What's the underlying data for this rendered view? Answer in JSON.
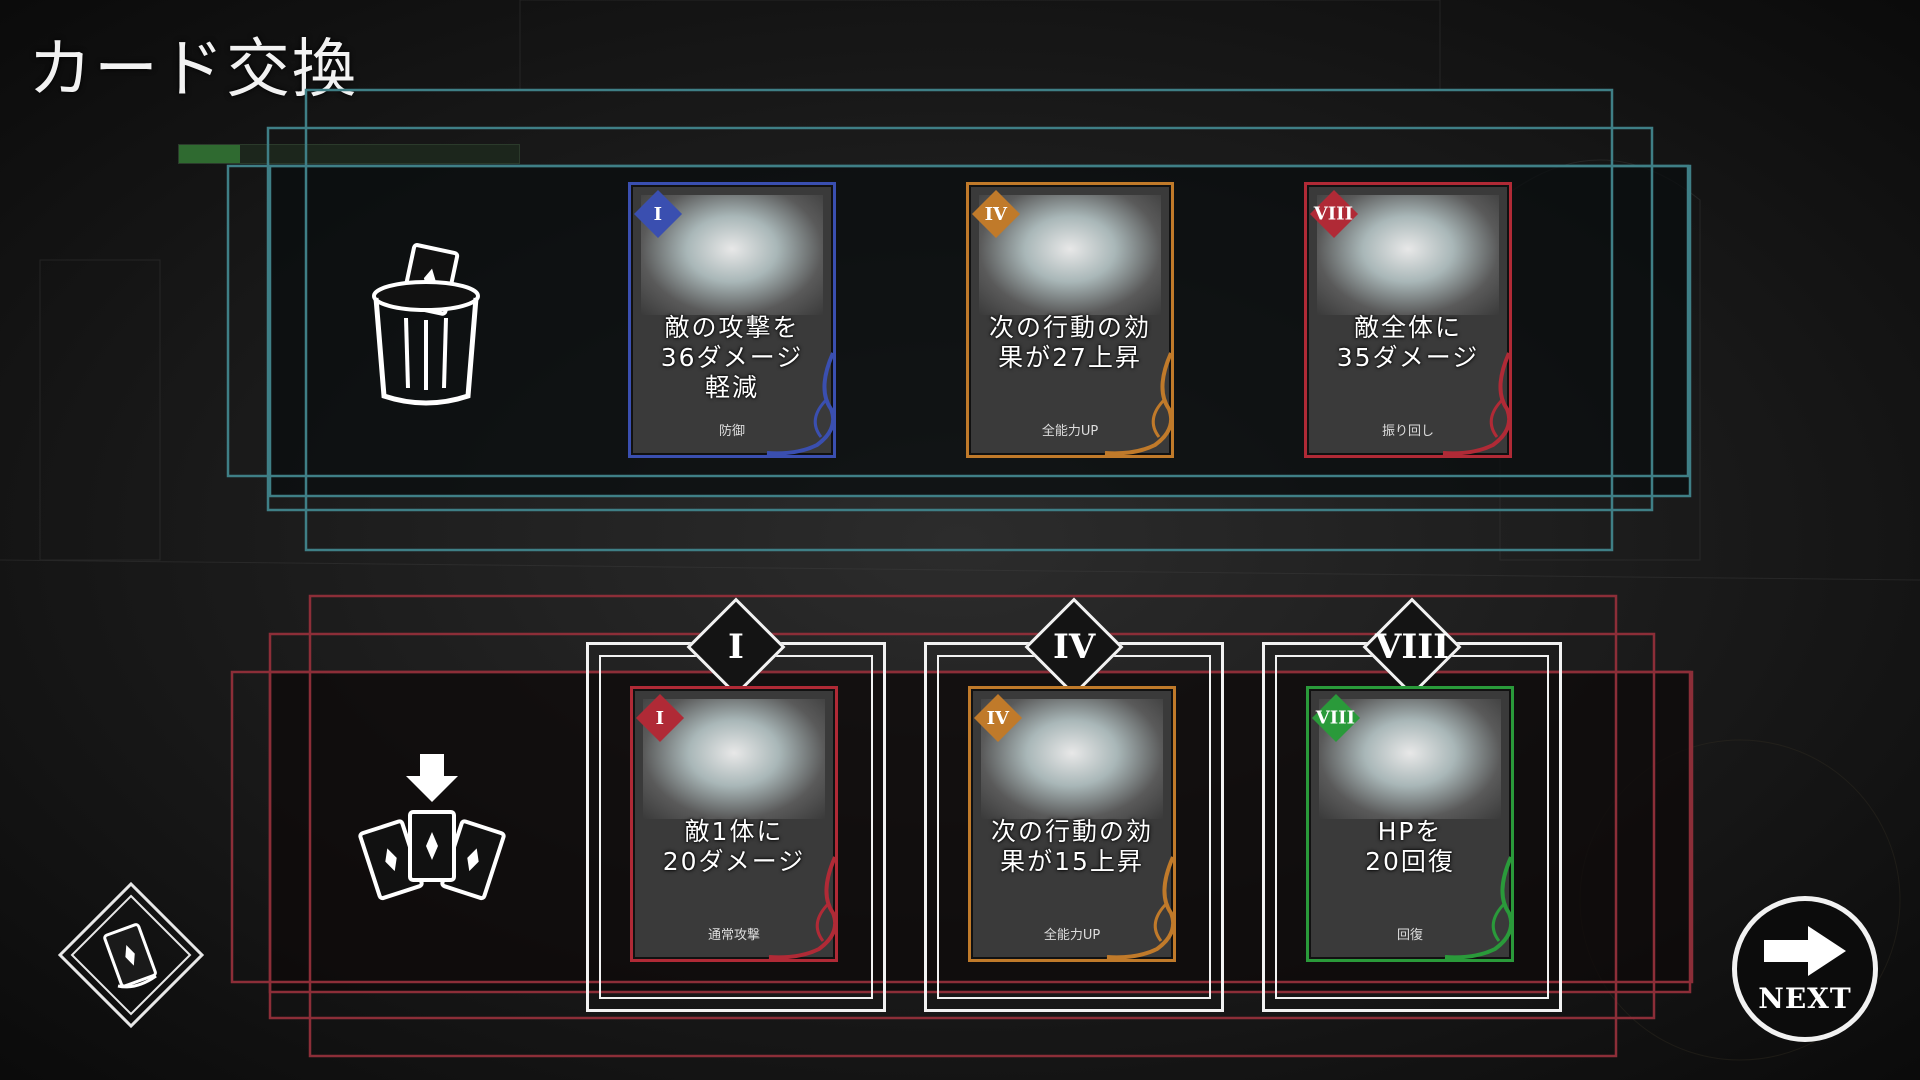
{
  "title": "カード交換",
  "hp": {
    "label": "",
    "ratio": 0.18
  },
  "colors": {
    "discard_frame": "#3f7f86",
    "hand_frame": "#8c2e38",
    "panel_bg": "#0a0d0f",
    "hand_bg": "#0e0909"
  },
  "discard_icon": "trash-can-with-card-icon",
  "draw_icon": "draw-cards-icon",
  "deck_icon": "deck-diamond-icon",
  "discard_cards": [
    {
      "numeral": "I",
      "color": "#3a4fb0",
      "text": "敵の攻撃を\n36ダメージ\n軽減",
      "type": "防御"
    },
    {
      "numeral": "IV",
      "color": "#c07a2a",
      "text": "次の行動の効\n果が27上昇",
      "type": "全能力UP"
    },
    {
      "numeral": "VIII",
      "color": "#b02a36",
      "text": "敵全体に\n35ダメージ",
      "type": "振り回し"
    }
  ],
  "hand_cards": [
    {
      "slot": "I",
      "numeral": "I",
      "color": "#b02a36",
      "text": "敵1体に\n20ダメージ",
      "type": "通常攻撃"
    },
    {
      "slot": "IV",
      "numeral": "IV",
      "color": "#c07a2a",
      "text": "次の行動の効\n果が15上昇",
      "type": "全能力UP"
    },
    {
      "slot": "VIII",
      "numeral": "VIII",
      "color": "#2a9a3a",
      "text": "HPを\n20回復",
      "type": "回復"
    }
  ],
  "next_button": {
    "label": "NEXT",
    "icon": "arrow-right-icon"
  }
}
